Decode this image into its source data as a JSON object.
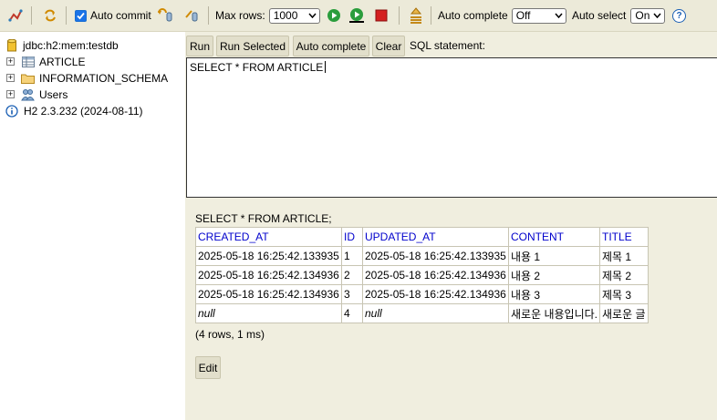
{
  "toolbar": {
    "icons": [
      "disconnect-icon",
      "refresh-icon",
      "rollback-icon",
      "commit-icon",
      "run-icon",
      "run-selected-icon",
      "stop-icon",
      "history-icon",
      "help-icon"
    ],
    "auto_commit_label": "Auto commit",
    "auto_commit_checked": true,
    "max_rows_label": "Max rows:",
    "max_rows_value": "1000",
    "auto_complete_label": "Auto complete",
    "auto_complete_value": "Off",
    "auto_select_label": "Auto select",
    "auto_select_value": "On",
    "help_glyph": "?"
  },
  "tree": {
    "connection": "jdbc:h2:mem:testdb",
    "items": [
      {
        "label": "ARTICLE",
        "icon": "table-icon"
      },
      {
        "label": "INFORMATION_SCHEMA",
        "icon": "folder-icon"
      },
      {
        "label": "Users",
        "icon": "users-icon"
      }
    ],
    "version": "H2 2.3.232 (2024-08-11)"
  },
  "query_buttons": {
    "run": "Run",
    "run_selected": "Run Selected",
    "auto_complete": "Auto complete",
    "clear": "Clear",
    "statement_label": "SQL statement:"
  },
  "editor": {
    "text": "SELECT * FROM ARTICLE"
  },
  "result": {
    "query": "SELECT * FROM ARTICLE;",
    "columns": [
      "CREATED_AT",
      "ID",
      "UPDATED_AT",
      "CONTENT",
      "TITLE"
    ],
    "rows": [
      [
        "2025-05-18 16:25:42.133935",
        "1",
        "2025-05-18 16:25:42.133935",
        "내용 1",
        "제목 1"
      ],
      [
        "2025-05-18 16:25:42.134936",
        "2",
        "2025-05-18 16:25:42.134936",
        "내용 2",
        "제목 2"
      ],
      [
        "2025-05-18 16:25:42.134936",
        "3",
        "2025-05-18 16:25:42.134936",
        "내용 3",
        "제목 3"
      ],
      [
        "null",
        "4",
        "null",
        "새로운 내용입니다.",
        "새로운 글"
      ]
    ],
    "summary": "(4 rows, 1 ms)",
    "edit_label": "Edit"
  },
  "colors": {
    "toolbar_bg": "#ecead9",
    "panel_bg": "#f0eedf",
    "header_link": "#0000cc",
    "run_green": "#2a9d3c",
    "stop_red": "#d42020"
  }
}
